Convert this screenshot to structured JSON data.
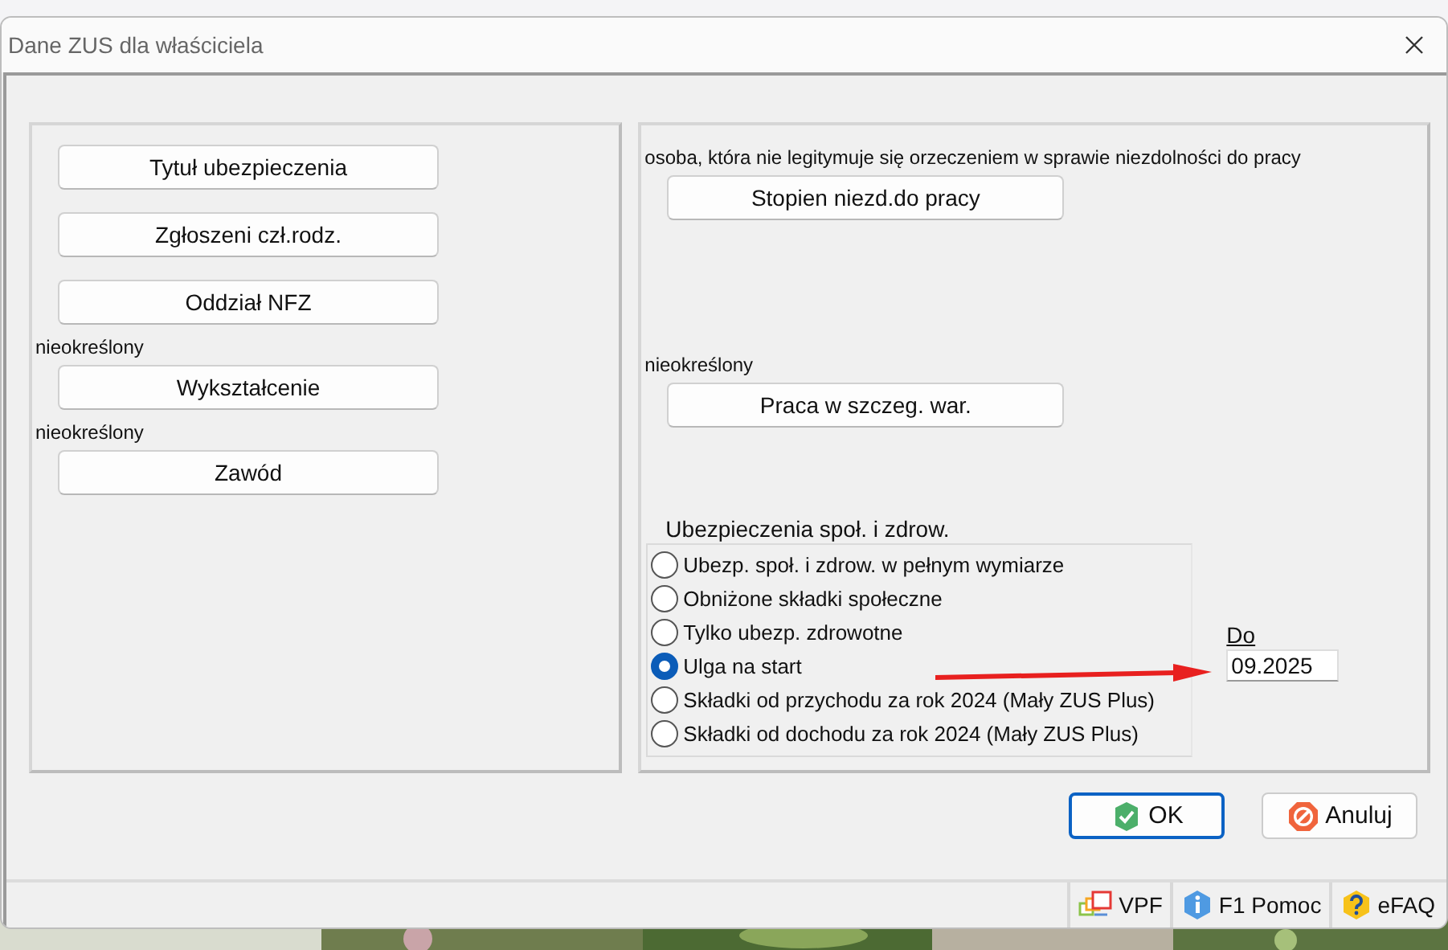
{
  "window": {
    "title": "Dane ZUS dla właściciela"
  },
  "left_panel": [
    {
      "kind": "button",
      "label": "Tytuł ubezpieczenia"
    },
    {
      "kind": "button",
      "label": "Zgłoszeni czł.rodz."
    },
    {
      "kind": "button",
      "label": "Oddział NFZ"
    },
    {
      "kind": "label",
      "label": "nieokreślony"
    },
    {
      "kind": "button",
      "label": "Wykształcenie"
    },
    {
      "kind": "label",
      "label": "nieokreślony"
    },
    {
      "kind": "button",
      "label": "Zawód"
    }
  ],
  "right_panel": [
    {
      "kind": "label",
      "label": "osoba, która nie legitymuje się orzeczeniem w sprawie niezdolności do pracy"
    },
    {
      "kind": "button",
      "label": "Stopien niezd.do pracy"
    },
    {
      "kind": "gap"
    },
    {
      "kind": "label",
      "label": "nieokreślony"
    },
    {
      "kind": "button",
      "label": "Praca w szczeg. war."
    },
    {
      "kind": "gap"
    }
  ],
  "insurance": {
    "title": "Ubezpieczenia społ. i zdrow.",
    "options": [
      {
        "label": "Ubezp. społ. i zdrow. w pełnym wymiarze",
        "selected": false
      },
      {
        "label": "Obniżone składki społeczne",
        "selected": false
      },
      {
        "label": "Tylko ubezp. zdrowotne",
        "selected": false
      },
      {
        "label": "Ulga na start",
        "selected": true
      },
      {
        "label": "Składki od przychodu za rok 2024 (Mały ZUS Plus)",
        "selected": false
      },
      {
        "label": "Składki od dochodu za rok 2024 (Mały ZUS Plus)",
        "selected": false
      }
    ],
    "until": {
      "label": "Do",
      "value": "09.2025"
    }
  },
  "buttons": [
    {
      "kind": "ok",
      "label": "OK"
    },
    {
      "kind": "cancel",
      "label": "Anuluj"
    }
  ],
  "status_bar": [
    {
      "kind": "vpf",
      "label": "VPF"
    },
    {
      "kind": "help",
      "label": "F1 Pomoc"
    },
    {
      "kind": "faq",
      "label": "eFAQ"
    }
  ]
}
